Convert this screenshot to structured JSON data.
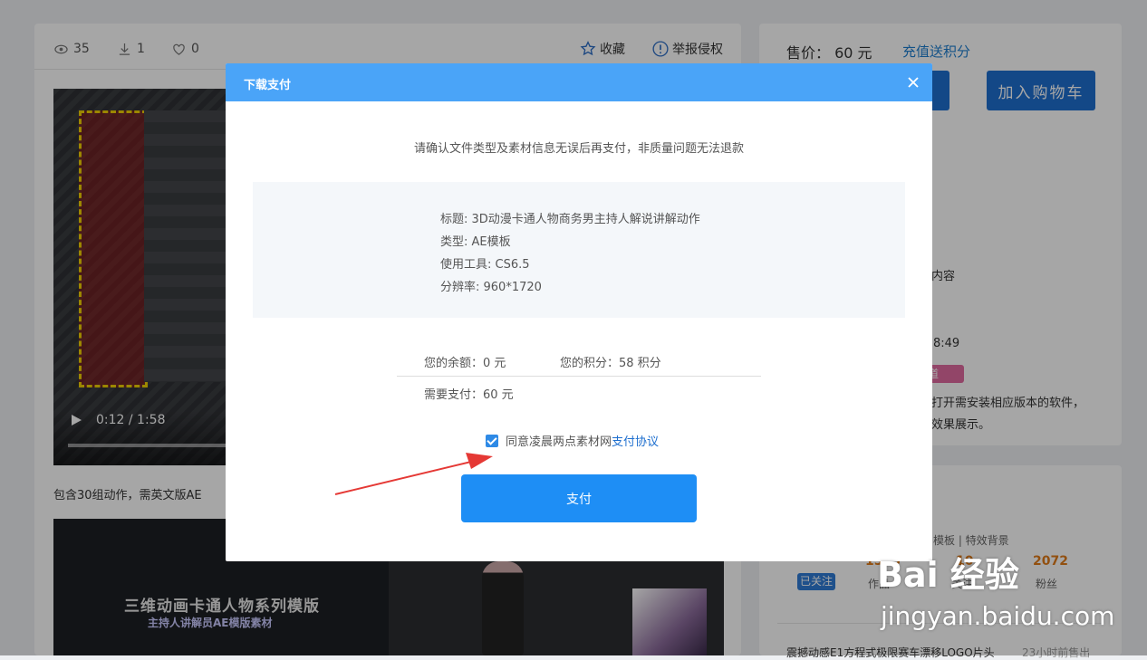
{
  "stats": {
    "views": "35",
    "downloads": "1",
    "likes": "0"
  },
  "actions": {
    "favorite": "收藏",
    "report": "举报侵权"
  },
  "video": {
    "time": "0:12 / 1:58"
  },
  "description": "包含30组动作，需英文版AE",
  "banner": {
    "title": "三维动画卡通人物系列模版",
    "subtitle": "主持人讲解员AE模版素材"
  },
  "sidebar": {
    "price_label": "售价：",
    "price_value": "60 元",
    "recharge": "充值送积分",
    "add_cart": "加入购物车",
    "content_frag": "内容",
    "time_frag": "8:49",
    "tag_frag": "道",
    "note_line1": "打开需安装相应版本的软件，",
    "note_line2": "效果展示。",
    "author_frag": "模板 | 特效背景",
    "followed": "已关注",
    "stat_a": "1585",
    "stat_a_label": "作品",
    "stat_b": "10",
    "stat_b_label": "关注",
    "stat_c": "2072",
    "stat_c_label": "粉丝",
    "bottom_item": "震撼动感E1方程式极限赛车漂移LOGO片头",
    "bottom_time": "23小时前售出"
  },
  "modal": {
    "title": "下载支付",
    "notice": "请确认文件类型及素材信息无误后再支付，非质量问题无法退款",
    "info": [
      "标题: 3D动漫卡通人物商务男主持人解说讲解动作",
      "类型: AE模板",
      "使用工具: CS6.5",
      "分辨率: 960*1720"
    ],
    "balance": "您的余额：0 元",
    "points": "您的积分：58 积分",
    "need_pay": "需要支付：60 元",
    "agree_text": "同意凌晨两点素材网",
    "agree_link": "支付协议",
    "pay_button": "支付"
  },
  "watermark": {
    "brand": "Bai 经验",
    "url": "jingyan.baidu.com"
  },
  "colors": {
    "modal_header": "#4aa4f8",
    "pay_button": "#1e8ef5",
    "link": "#1e6fcf",
    "arrow": "#e53935"
  }
}
